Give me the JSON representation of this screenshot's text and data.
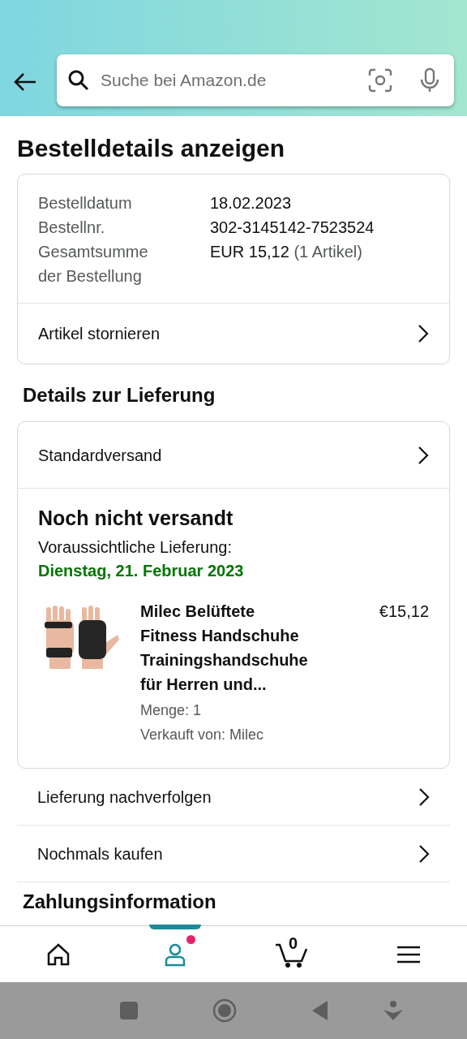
{
  "search": {
    "placeholder": "Suche bei Amazon.de"
  },
  "title": "Bestelldetails anzeigen",
  "order_summary": {
    "rows": [
      {
        "label": "Bestelldatum",
        "value": "18.02.2023"
      },
      {
        "label": "Bestellnr.",
        "value": "302-3145142-7523524"
      },
      {
        "label": "Gesamtsumme der Bestellung",
        "value": "EUR 15,12",
        "note": "(1 Artikel)"
      }
    ],
    "action": "Artikel stornieren"
  },
  "delivery": {
    "heading": "Details zur Lieferung",
    "shipping": "Standardversand",
    "status": "Noch nicht versandt",
    "expected_label": "Voraussichtliche Lieferung:",
    "expected_date": "Dienstag, 21. Februar 2023",
    "item": {
      "title": "Milec Belüftete Fitness Handschuhe Trainingshandschuhe für Herren und...",
      "price": "€15,12",
      "quantity": "Menge: 1",
      "seller": "Verkauft von: Milec"
    }
  },
  "actions": [
    "Lieferung nachverfolgen",
    "Nochmals kaufen"
  ],
  "next_heading": "Zahlungsinformation",
  "bottom_nav": [
    {
      "kind": "home",
      "selected": false
    },
    {
      "kind": "account",
      "selected": true,
      "notification": true
    },
    {
      "kind": "cart",
      "selected": false,
      "count": "0"
    },
    {
      "kind": "menu",
      "selected": false
    }
  ]
}
